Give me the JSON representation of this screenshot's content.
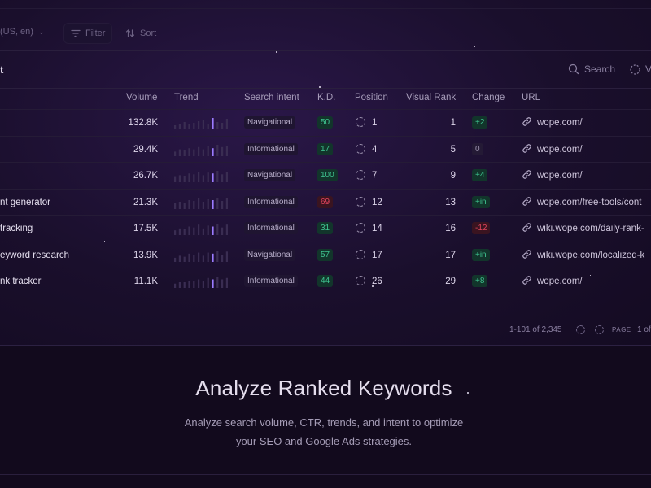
{
  "toolbar": {
    "locale": "(US, en)",
    "filter_label": "Filter",
    "sort_label": "Sort"
  },
  "section": {
    "title": "t",
    "search_label": "Search",
    "view_label": "V"
  },
  "table": {
    "headers": {
      "volume": "Volume",
      "trend": "Trend",
      "intent": "Search intent",
      "kd": "K.D.",
      "position": "Position",
      "visual_rank": "Visual Rank",
      "change": "Change",
      "url": "URL"
    },
    "rows": [
      {
        "keyword": "",
        "volume": "132.8K",
        "trend": [
          5,
          7,
          9,
          6,
          8,
          10,
          12,
          7,
          14,
          9,
          8,
          13
        ],
        "trend_highlight": 8,
        "intent": "Navigational",
        "kd": "50",
        "kd_level": "green",
        "position": "1",
        "visual_rank": "1",
        "change": "+2",
        "change_type": "pos",
        "url": "wope.com/"
      },
      {
        "keyword": "",
        "volume": "29.4K",
        "trend": [
          4,
          6,
          5,
          7,
          6,
          8,
          6,
          9,
          7,
          10,
          8,
          9
        ],
        "trend_highlight": 8,
        "intent": "Informational",
        "kd": "17",
        "kd_level": "green",
        "position": "4",
        "visual_rank": "5",
        "change": "0",
        "change_type": "zero",
        "url": "wope.com/"
      },
      {
        "keyword": "",
        "volume": "26.7K",
        "trend": [
          6,
          8,
          7,
          10,
          9,
          12,
          8,
          11,
          10,
          13,
          9,
          12
        ],
        "trend_highlight": 8,
        "intent": "Navigational",
        "kd": "100",
        "kd_level": "green",
        "position": "7",
        "visual_rank": "9",
        "change": "+4",
        "change_type": "pos",
        "url": "wope.com/"
      },
      {
        "keyword": "nt generator",
        "volume": "21.3K",
        "trend": [
          7,
          9,
          8,
          11,
          10,
          13,
          9,
          12,
          11,
          14,
          10,
          13
        ],
        "trend_highlight": 8,
        "intent": "Informational",
        "kd": "69",
        "kd_level": "red",
        "position": "12",
        "visual_rank": "13",
        "change": "+in",
        "change_type": "pos",
        "url": "wope.com/free-tools/cont"
      },
      {
        "keyword": "tracking",
        "volume": "17.5K",
        "trend": [
          5,
          7,
          6,
          9,
          8,
          11,
          7,
          10,
          9,
          12,
          8,
          11
        ],
        "trend_highlight": 8,
        "intent": "Informational",
        "kd": "31",
        "kd_level": "green",
        "position": "14",
        "visual_rank": "16",
        "change": "-12",
        "change_type": "neg",
        "url": "wiki.wope.com/daily-rank-"
      },
      {
        "keyword": "eyword research",
        "volume": "13.9K",
        "trend": [
          4,
          6,
          5,
          8,
          7,
          9,
          6,
          9,
          8,
          11,
          7,
          10
        ],
        "trend_highlight": 8,
        "intent": "Navigational",
        "kd": "57",
        "kd_level": "green",
        "position": "17",
        "visual_rank": "17",
        "change": "+in",
        "change_type": "pos",
        "url": "wiki.wope.com/localized-k"
      },
      {
        "keyword": "nk tracker",
        "volume": "11.1K",
        "trend": [
          3,
          4,
          4,
          5,
          5,
          6,
          5,
          7,
          6,
          8,
          6,
          7
        ],
        "trend_highlight": 8,
        "intent": "Informational",
        "kd": "44",
        "kd_level": "green",
        "position": "26",
        "visual_rank": "29",
        "change": "+8",
        "change_type": "pos",
        "url": "wope.com/"
      }
    ]
  },
  "pagination": {
    "range": "1-101 of 2,345",
    "page_label": "PAGE",
    "of_label": "1 of"
  },
  "hero": {
    "title": "Analyze Ranked Keywords",
    "subtitle_line1": "Analyze search volume, CTR, trends, and intent to optimize",
    "subtitle_line2": "your SEO and Google Ads strategies."
  },
  "colors": {
    "background": "#120a1d",
    "accent": "#9b7bff",
    "positive": "#3fc490",
    "negative": "#e2445c"
  }
}
